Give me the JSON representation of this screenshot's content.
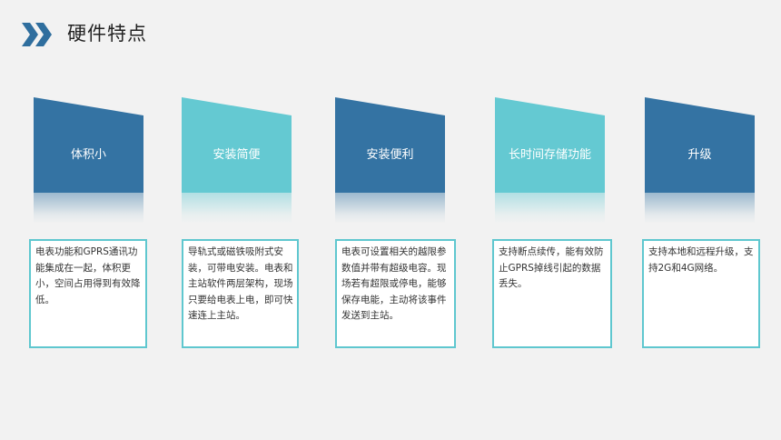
{
  "header": {
    "title": "硬件特点",
    "icon": "chevron-double-right-icon",
    "accent": "#2f6e9e"
  },
  "colors": {
    "dark": "#3473a3",
    "light": "#64c9d2",
    "border": "#5fc7cf"
  },
  "cards": [
    {
      "label": "体积小",
      "description": "电表功能和GPRS通讯功能集成在一起，体积更小，空间占用得到有效降低。"
    },
    {
      "label": "安装简便",
      "description": "导轨式或磁铁吸附式安装，可带电安装。电表和主站软件两层架构，现场只要给电表上电，即可快速连上主站。"
    },
    {
      "label": "安装便利",
      "description": "电表可设置相关的越限参数值并带有超级电容。现场若有超限或停电，能够保存电能，主动将该事件发送到主站。"
    },
    {
      "label": "长时间存储功能",
      "description": "支持断点续传，能有效防止GPRS掉线引起的数据丢失。"
    },
    {
      "label": "升级",
      "description": "支持本地和远程升级，支持2G和4G网络。"
    }
  ]
}
